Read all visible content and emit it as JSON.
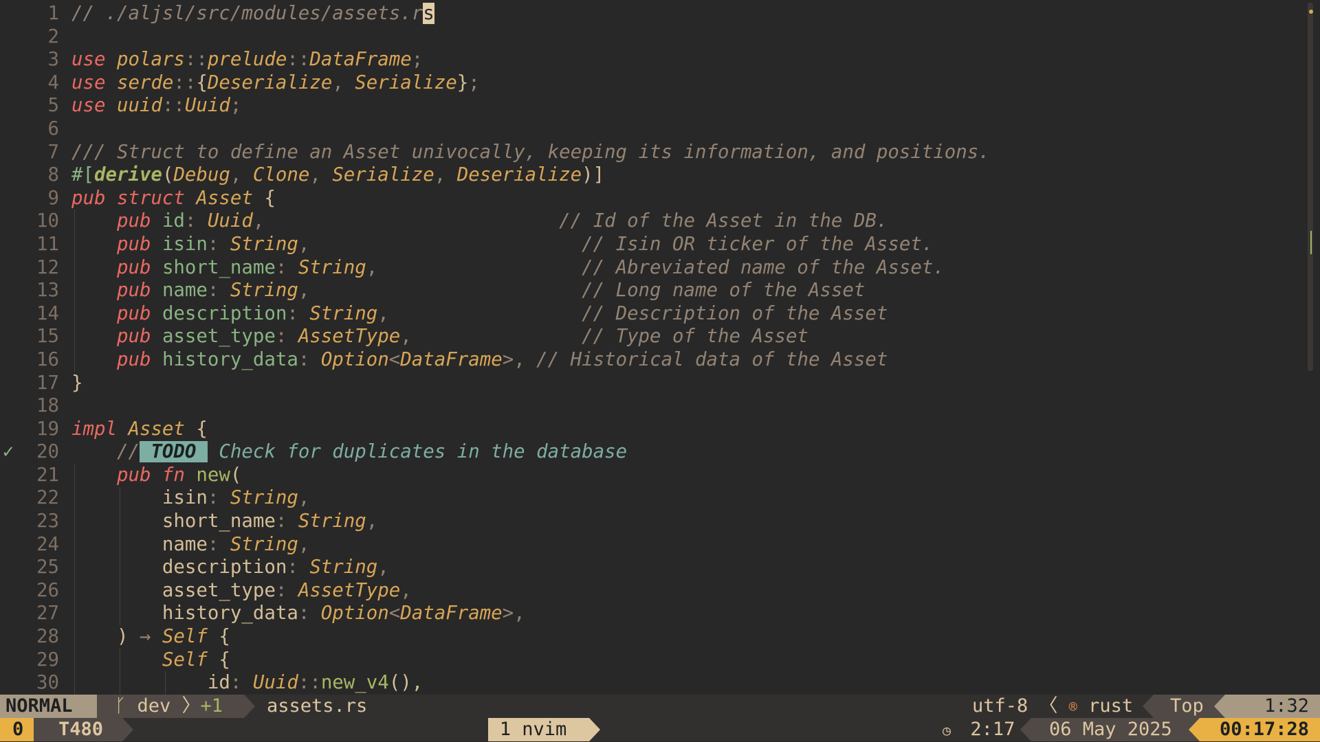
{
  "editor": {
    "lines": [
      {
        "n": "1",
        "t": [
          [
            "// ./aljsl/src/modules/assets.r",
            "cm"
          ],
          [
            "s",
            "cursor"
          ]
        ]
      },
      {
        "n": "2",
        "t": []
      },
      {
        "n": "3",
        "t": [
          [
            "use ",
            "kw"
          ],
          [
            "polars",
            "ty"
          ],
          [
            "::",
            "op"
          ],
          [
            "prelude",
            "ty"
          ],
          [
            "::",
            "op"
          ],
          [
            "DataFrame",
            "ty"
          ],
          [
            ";",
            "op"
          ]
        ]
      },
      {
        "n": "4",
        "t": [
          [
            "use ",
            "kw"
          ],
          [
            "serde",
            "ty"
          ],
          [
            "::",
            "op"
          ],
          [
            "{",
            "tx"
          ],
          [
            "Deserialize",
            "ty"
          ],
          [
            ", ",
            "op"
          ],
          [
            "Serialize",
            "ty"
          ],
          [
            "}",
            "tx"
          ],
          [
            ";",
            "op"
          ]
        ]
      },
      {
        "n": "5",
        "t": [
          [
            "use ",
            "kw"
          ],
          [
            "uuid",
            "ty"
          ],
          [
            "::",
            "op"
          ],
          [
            "Uuid",
            "ty"
          ],
          [
            ";",
            "op"
          ]
        ]
      },
      {
        "n": "6",
        "t": []
      },
      {
        "n": "7",
        "t": [
          [
            "/// Struct to define an Asset univocally, keeping its information, and positions.",
            "cm"
          ]
        ]
      },
      {
        "n": "8",
        "t": [
          [
            "#[",
            "aq"
          ],
          [
            "derive",
            "fnb"
          ],
          [
            "(",
            "tx"
          ],
          [
            "Debug",
            "ty"
          ],
          [
            ", ",
            "op"
          ],
          [
            "Clone",
            "ty"
          ],
          [
            ", ",
            "op"
          ],
          [
            "Serialize",
            "ty"
          ],
          [
            ", ",
            "op"
          ],
          [
            "Deserialize",
            "ty"
          ],
          [
            ")]",
            "tx"
          ]
        ]
      },
      {
        "n": "9",
        "t": [
          [
            "pub struct ",
            "kw"
          ],
          [
            "Asset",
            "ty"
          ],
          [
            " {",
            "tx"
          ]
        ]
      },
      {
        "n": "10",
        "t": [
          [
            "    pub ",
            "kw"
          ],
          [
            "id",
            "aq"
          ],
          [
            ": ",
            "op"
          ],
          [
            "Uuid",
            "ty"
          ],
          [
            ",                          ",
            "op"
          ],
          [
            "// Id of the Asset in the DB.",
            "cm"
          ]
        ]
      },
      {
        "n": "11",
        "t": [
          [
            "    pub ",
            "kw"
          ],
          [
            "isin",
            "aq"
          ],
          [
            ": ",
            "op"
          ],
          [
            "String",
            "ty"
          ],
          [
            ",                        ",
            "op"
          ],
          [
            "// Isin OR ticker of the Asset.",
            "cm"
          ]
        ]
      },
      {
        "n": "12",
        "t": [
          [
            "    pub ",
            "kw"
          ],
          [
            "short_name",
            "aq"
          ],
          [
            ": ",
            "op"
          ],
          [
            "String",
            "ty"
          ],
          [
            ",                  ",
            "op"
          ],
          [
            "// Abreviated name of the Asset.",
            "cm"
          ]
        ]
      },
      {
        "n": "13",
        "t": [
          [
            "    pub ",
            "kw"
          ],
          [
            "name",
            "aq"
          ],
          [
            ": ",
            "op"
          ],
          [
            "String",
            "ty"
          ],
          [
            ",                        ",
            "op"
          ],
          [
            "// Long name of the Asset",
            "cm"
          ]
        ]
      },
      {
        "n": "14",
        "t": [
          [
            "    pub ",
            "kw"
          ],
          [
            "description",
            "aq"
          ],
          [
            ": ",
            "op"
          ],
          [
            "String",
            "ty"
          ],
          [
            ",                 ",
            "op"
          ],
          [
            "// Description of the Asset",
            "cm"
          ]
        ]
      },
      {
        "n": "15",
        "t": [
          [
            "    pub ",
            "kw"
          ],
          [
            "asset_type",
            "aq"
          ],
          [
            ": ",
            "op"
          ],
          [
            "AssetType",
            "ty"
          ],
          [
            ",               ",
            "op"
          ],
          [
            "// Type of the Asset",
            "cm"
          ]
        ]
      },
      {
        "n": "16",
        "t": [
          [
            "    pub ",
            "kw"
          ],
          [
            "history_data",
            "aq"
          ],
          [
            ": ",
            "op"
          ],
          [
            "Option",
            "ty"
          ],
          [
            "<",
            "op"
          ],
          [
            "DataFrame",
            "ty"
          ],
          [
            ">",
            "op"
          ],
          [
            ", ",
            "op"
          ],
          [
            "// Historical data of the Asset",
            "cm"
          ]
        ]
      },
      {
        "n": "17",
        "t": [
          [
            "}",
            "tx"
          ]
        ]
      },
      {
        "n": "18",
        "t": []
      },
      {
        "n": "19",
        "t": [
          [
            "impl ",
            "kw"
          ],
          [
            "Asset",
            "ty"
          ],
          [
            " {",
            "tx"
          ]
        ]
      },
      {
        "n": "20",
        "sign": "✓",
        "t": [
          [
            "    //",
            "cm"
          ],
          [
            " TODO ",
            "todo"
          ],
          [
            " Check for duplicates in the database",
            "todoc"
          ]
        ]
      },
      {
        "n": "21",
        "t": [
          [
            "    pub fn ",
            "kw"
          ],
          [
            "new",
            "fn"
          ],
          [
            "(",
            "tx"
          ]
        ]
      },
      {
        "n": "22",
        "t": [
          [
            "        isin",
            "fd"
          ],
          [
            ": ",
            "op"
          ],
          [
            "String",
            "ty"
          ],
          [
            ",",
            "op"
          ]
        ]
      },
      {
        "n": "23",
        "t": [
          [
            "        short_name",
            "fd"
          ],
          [
            ": ",
            "op"
          ],
          [
            "String",
            "ty"
          ],
          [
            ",",
            "op"
          ]
        ]
      },
      {
        "n": "24",
        "t": [
          [
            "        name",
            "fd"
          ],
          [
            ": ",
            "op"
          ],
          [
            "String",
            "ty"
          ],
          [
            ",",
            "op"
          ]
        ]
      },
      {
        "n": "25",
        "t": [
          [
            "        description",
            "fd"
          ],
          [
            ": ",
            "op"
          ],
          [
            "String",
            "ty"
          ],
          [
            ",",
            "op"
          ]
        ]
      },
      {
        "n": "26",
        "t": [
          [
            "        asset_type",
            "fd"
          ],
          [
            ": ",
            "op"
          ],
          [
            "AssetType",
            "ty"
          ],
          [
            ",",
            "op"
          ]
        ]
      },
      {
        "n": "27",
        "t": [
          [
            "        history_data",
            "fd"
          ],
          [
            ": ",
            "op"
          ],
          [
            "Option",
            "ty"
          ],
          [
            "<",
            "op"
          ],
          [
            "DataFrame",
            "ty"
          ],
          [
            ">",
            "op"
          ],
          [
            ",",
            "op"
          ]
        ]
      },
      {
        "n": "28",
        "t": [
          [
            "    ) ",
            "tx"
          ],
          [
            "→ ",
            "op"
          ],
          [
            "Self",
            "ty"
          ],
          [
            " {",
            "tx"
          ]
        ]
      },
      {
        "n": "29",
        "t": [
          [
            "        Self",
            "ty"
          ],
          [
            " {",
            "tx"
          ]
        ]
      },
      {
        "n": "30",
        "t": [
          [
            "            id",
            "fd"
          ],
          [
            ": ",
            "op"
          ],
          [
            "Uuid",
            "ty"
          ],
          [
            "::",
            "op"
          ],
          [
            "new_v4",
            "fn"
          ],
          [
            "(),",
            "tx"
          ]
        ]
      }
    ]
  },
  "statusline": {
    "mode": "NORMAL",
    "branch_icon": "git-branch-icon",
    "branch": "dev",
    "diff": "+1",
    "filename": "assets.rs",
    "encoding": "utf-8",
    "filetype_icon": "rust-icon",
    "filetype": "rust",
    "position": "Top",
    "cursor": "1:32"
  },
  "tmux": {
    "session": "0",
    "host": "T480",
    "window": "1 nvim",
    "clock_icon": "clock-icon",
    "time": "2:17",
    "date": "06 May 2025",
    "elapsed": "00:17:28"
  },
  "colors": {
    "bg": "#292828",
    "keyword": "#ea6962",
    "type": "#d8a657",
    "accent": "#e9b143",
    "todo": "#7daea3"
  }
}
